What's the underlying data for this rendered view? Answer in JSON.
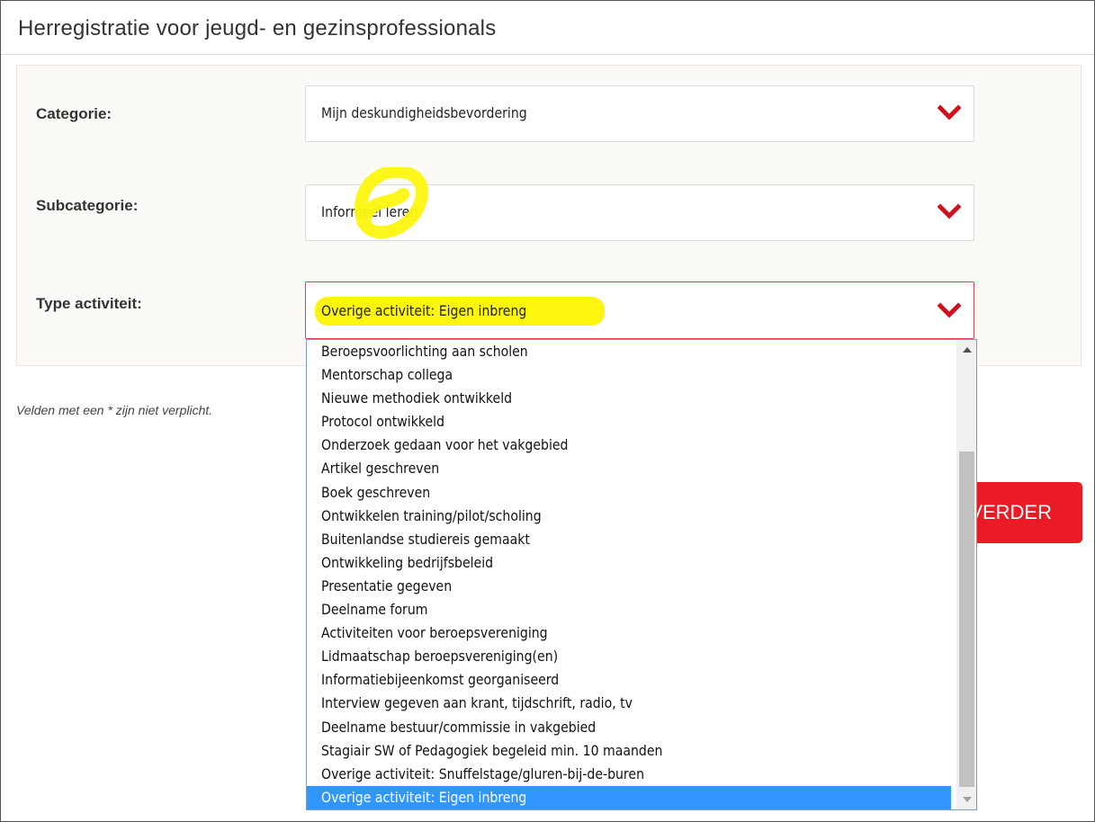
{
  "page": {
    "title": "Herregistratie voor jeugd- en gezinsprofessionals",
    "note": "Velden met een * zijn niet verplicht.",
    "next_button": "VERDER"
  },
  "form": {
    "category": {
      "label": "Categorie:",
      "value": "Mijn deskundigheidsbevordering"
    },
    "subcategory": {
      "label": "Subcategorie:",
      "value": "Informeel leren"
    },
    "activity_type": {
      "label": "Type activiteit:",
      "value": "Overige activiteit: Eigen inbreng"
    }
  },
  "dropdown": {
    "options": [
      "Beroepsvoorlichting aan scholen",
      "Mentorschap collega",
      "Nieuwe methodiek ontwikkeld",
      "Protocol ontwikkeld",
      "Onderzoek gedaan voor het vakgebied",
      "Artikel geschreven",
      "Boek geschreven",
      "Ontwikkelen training/pilot/scholing",
      "Buitenlandse studiereis gemaakt",
      "Ontwikkeling bedrijfsbeleid",
      "Presentatie gegeven",
      "Deelname forum",
      "Activiteiten voor beroepsvereniging",
      "Lidmaatschap beroepsvereniging(en)",
      "Informatiebijeenkomst georganiseerd",
      "Interview gegeven aan krant, tijdschrift, radio, tv",
      "Deelname bestuur/commissie in vakgebied",
      "Stagiair SW of Pedagogiek begeleid min. 10 maanden",
      "Overige activiteit: Snuffelstage/gluren-bij-de-buren",
      "Overige activiteit: Eigen inbreng"
    ],
    "selected_index": 19
  },
  "colors": {
    "accent_red": "#ea1b24",
    "chevron_red": "#d0121e",
    "highlight_yellow": "#fcf50f",
    "selected_blue": "#3296ff"
  },
  "icons": {
    "chevron": "chevron-down-icon",
    "scroll_up": "scroll-up-arrow-icon",
    "scroll_down": "scroll-down-arrow-icon"
  }
}
